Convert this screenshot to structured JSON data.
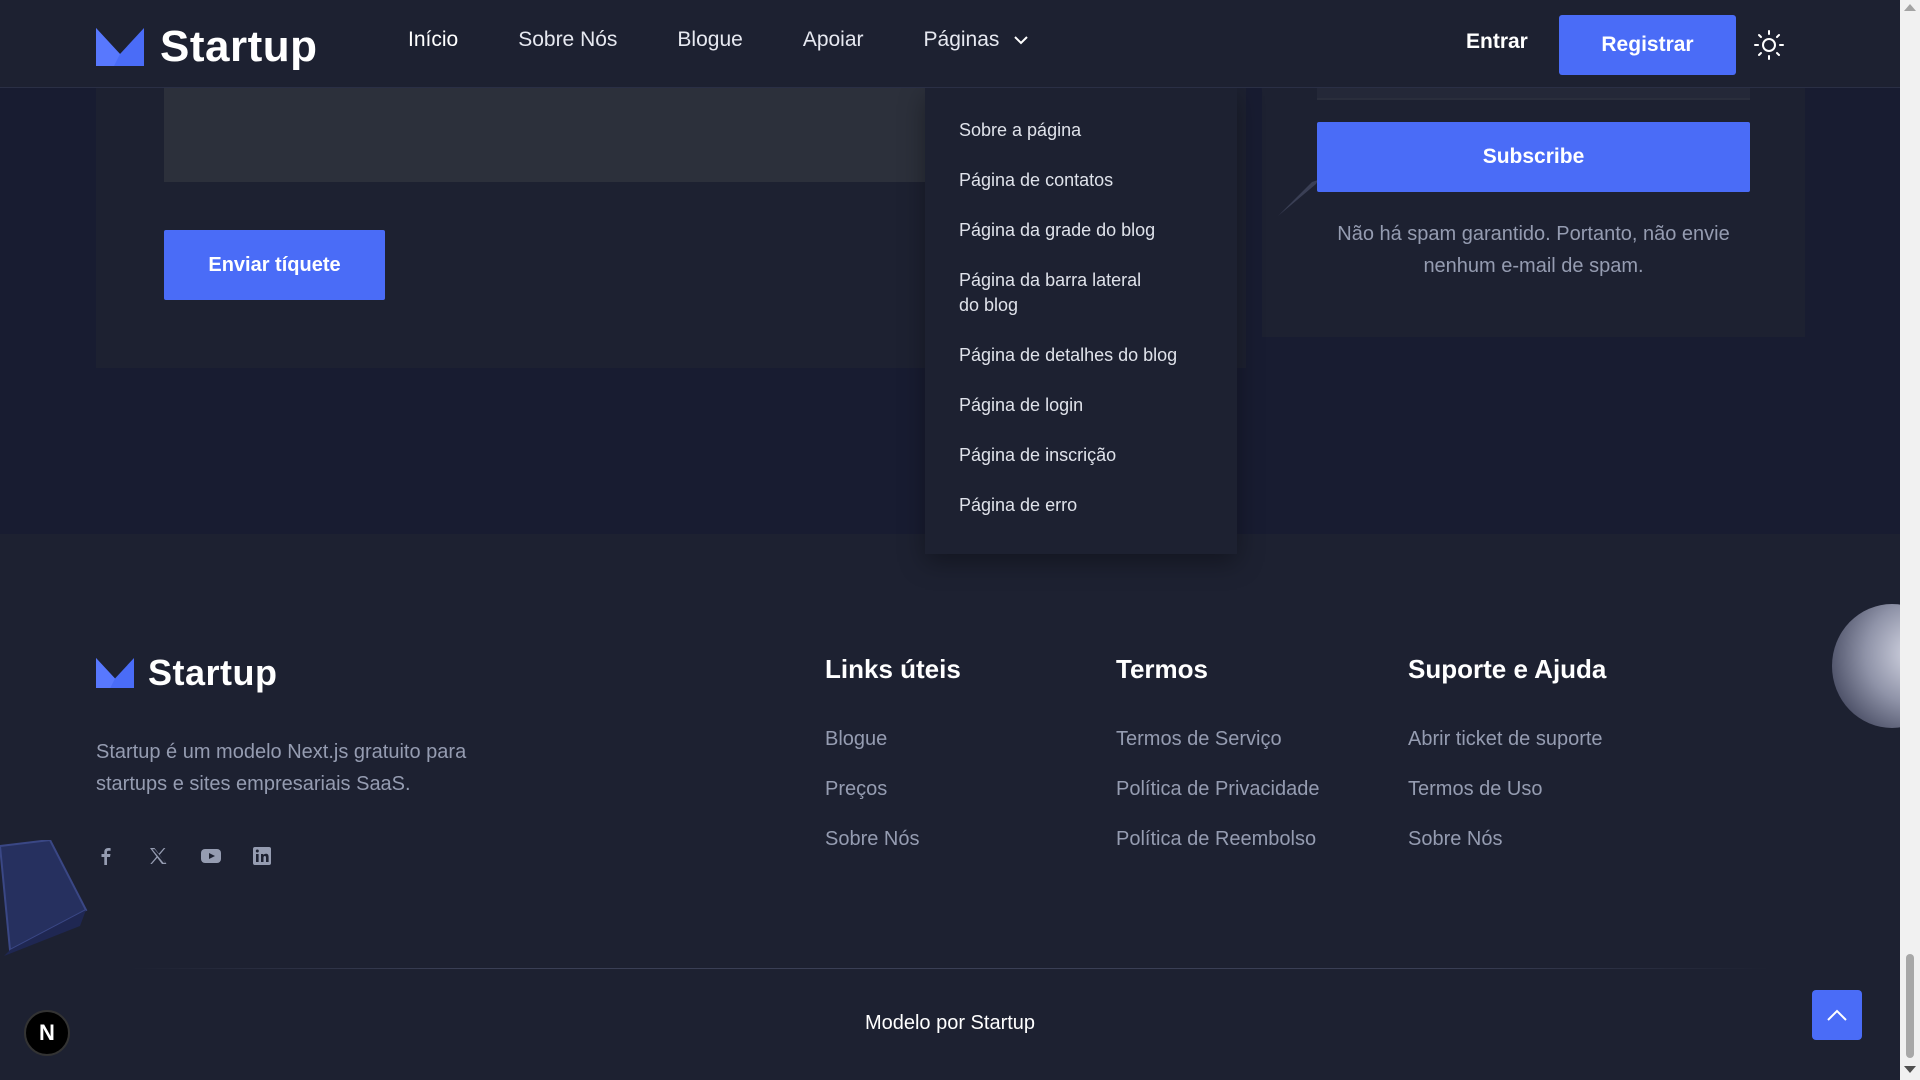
{
  "brand": {
    "name": "Startup",
    "accent": "#4a6cf7"
  },
  "nav": {
    "items": [
      "Início",
      "Sobre Nós",
      "Blogue",
      "Apoiar",
      "Páginas"
    ],
    "signin": "Entrar",
    "register": "Registrar"
  },
  "dropdown": {
    "items": [
      "Sobre a página",
      "Página de contatos",
      "Página da grade do blog",
      "Página da barra lateral do blog",
      "Página de detalhes do blog",
      "Página de login",
      "Página de inscrição",
      "Página de erro"
    ]
  },
  "ticket": {
    "send_label": "Enviar tíquete"
  },
  "newsletter": {
    "subscribe_label": "Subscribe",
    "note": "Não há spam garantido. Portanto, não envie nenhum e-mail de spam."
  },
  "footer": {
    "description": "Startup é um modelo Next.js gratuito para startups e sites empresariais SaaS.",
    "social_icons": [
      "facebook-icon",
      "x-icon",
      "youtube-icon",
      "linkedin-icon"
    ],
    "columns": [
      {
        "title": "Links úteis",
        "links": [
          "Blogue",
          "Preços",
          "Sobre Nós"
        ]
      },
      {
        "title": "Termos",
        "links": [
          "Termos de Serviço",
          "Política de Privacidade",
          "Política de Reembolso"
        ]
      },
      {
        "title": "Suporte e Ajuda",
        "links": [
          "Abrir ticket de suporte",
          "Termos de Uso",
          "Sobre Nós"
        ]
      }
    ],
    "credit": "Modelo por Startup"
  },
  "next_badge": "N"
}
